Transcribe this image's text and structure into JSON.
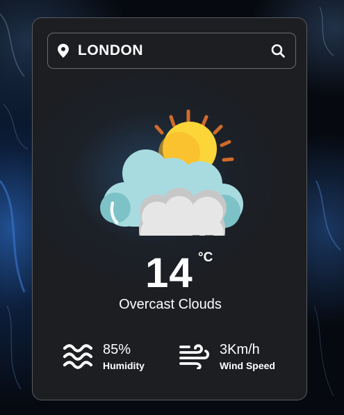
{
  "search": {
    "value": "LONDON",
    "placeholder": "",
    "location_icon": "location-pin-icon",
    "search_icon": "search-icon"
  },
  "weather": {
    "icon": "cloudy-sun-icon",
    "temperature": "14",
    "unit": "°C",
    "description": "Overcast Clouds"
  },
  "details": {
    "humidity": {
      "icon": "humidity-waves-icon",
      "value": "85%",
      "label": "Humidity"
    },
    "wind": {
      "icon": "wind-icon",
      "value": "3Km/h",
      "label": "Wind Speed"
    }
  },
  "colors": {
    "card": "#1c1e22",
    "background": "#06090f",
    "text": "#ffffff",
    "sun": "#fcd539",
    "sun_rays": "#d06b2a",
    "cloud_back": "#a8dbe0",
    "cloud_front": "#e6e6e6"
  }
}
